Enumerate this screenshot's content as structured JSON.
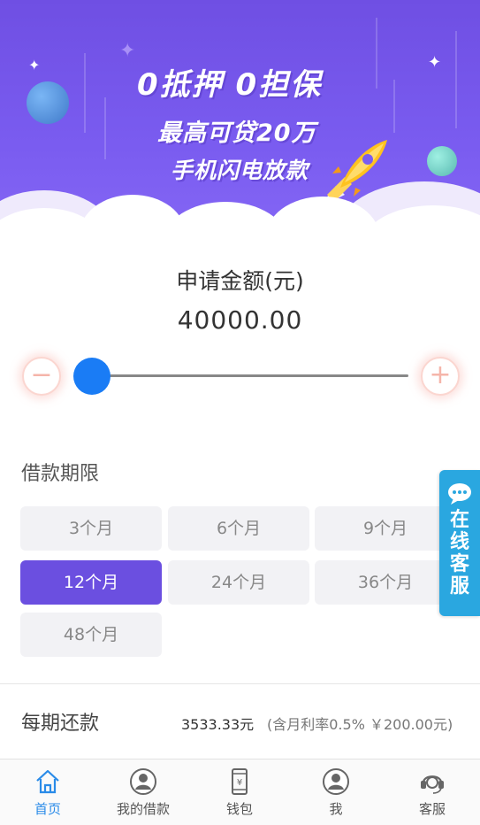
{
  "banner": {
    "line1": "0抵押  0担保",
    "line2": "最高可贷20万",
    "line3": "手机闪电放款"
  },
  "amount": {
    "label": "申请金额(元)",
    "value": "40000.00",
    "minus_symbol": "−",
    "plus_symbol": "+",
    "slider_fraction": 0.0
  },
  "term": {
    "title": "借款期限",
    "options": [
      "3个月",
      "6个月",
      "9个月",
      "12个月",
      "24个月",
      "36个月",
      "48个月"
    ],
    "selected": "12个月"
  },
  "float_service": {
    "label": "在线客服"
  },
  "repayment": {
    "label": "每期还款",
    "amount": "3533.33元",
    "note": "(含月利率0.5% ￥200.00元)"
  },
  "nav": {
    "items": [
      {
        "label": "首页",
        "icon": "home-icon"
      },
      {
        "label": "我的借款",
        "icon": "user-icon"
      },
      {
        "label": "钱包",
        "icon": "wallet-phone-icon"
      },
      {
        "label": "我",
        "icon": "user-icon"
      },
      {
        "label": "客服",
        "icon": "headset-icon"
      }
    ],
    "active_index": 0
  },
  "colors": {
    "banner": "#7355ec",
    "accent": "#6b4fe0",
    "slider_thumb": "#1a7cf5",
    "service": "#2aa7e0",
    "nav_active": "#2a8be8"
  }
}
